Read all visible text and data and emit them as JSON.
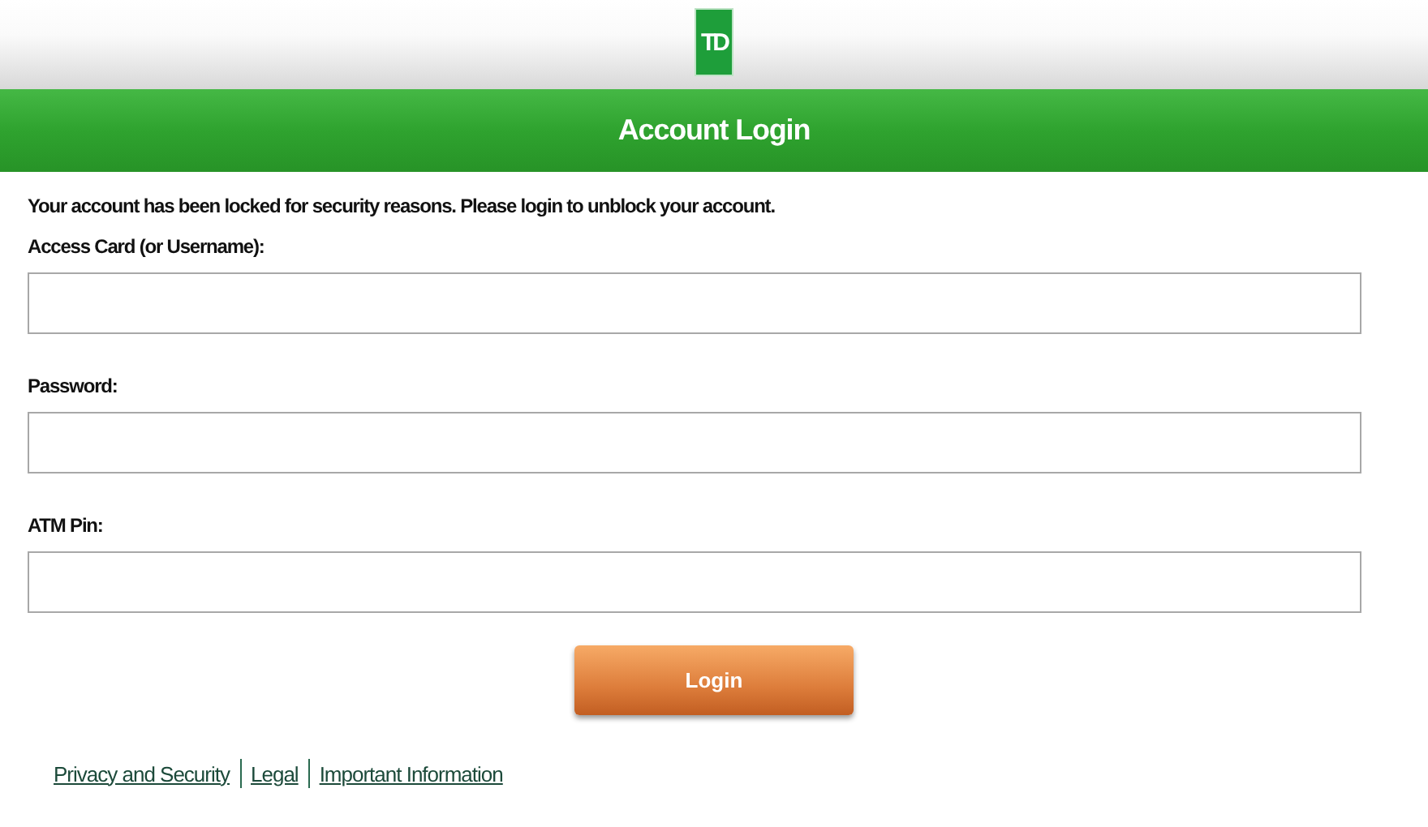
{
  "logo": {
    "text": "TD"
  },
  "banner": {
    "title": "Account Login"
  },
  "message": "Your account has been locked for security reasons. Please login to unblock your account.",
  "fields": [
    {
      "label": "Access Card (or Username):"
    },
    {
      "label": "Password:"
    },
    {
      "label": "ATM Pin:"
    }
  ],
  "button": {
    "label": "Login"
  },
  "footer_links": [
    "Privacy and Security",
    "Legal",
    "Important Information"
  ]
}
